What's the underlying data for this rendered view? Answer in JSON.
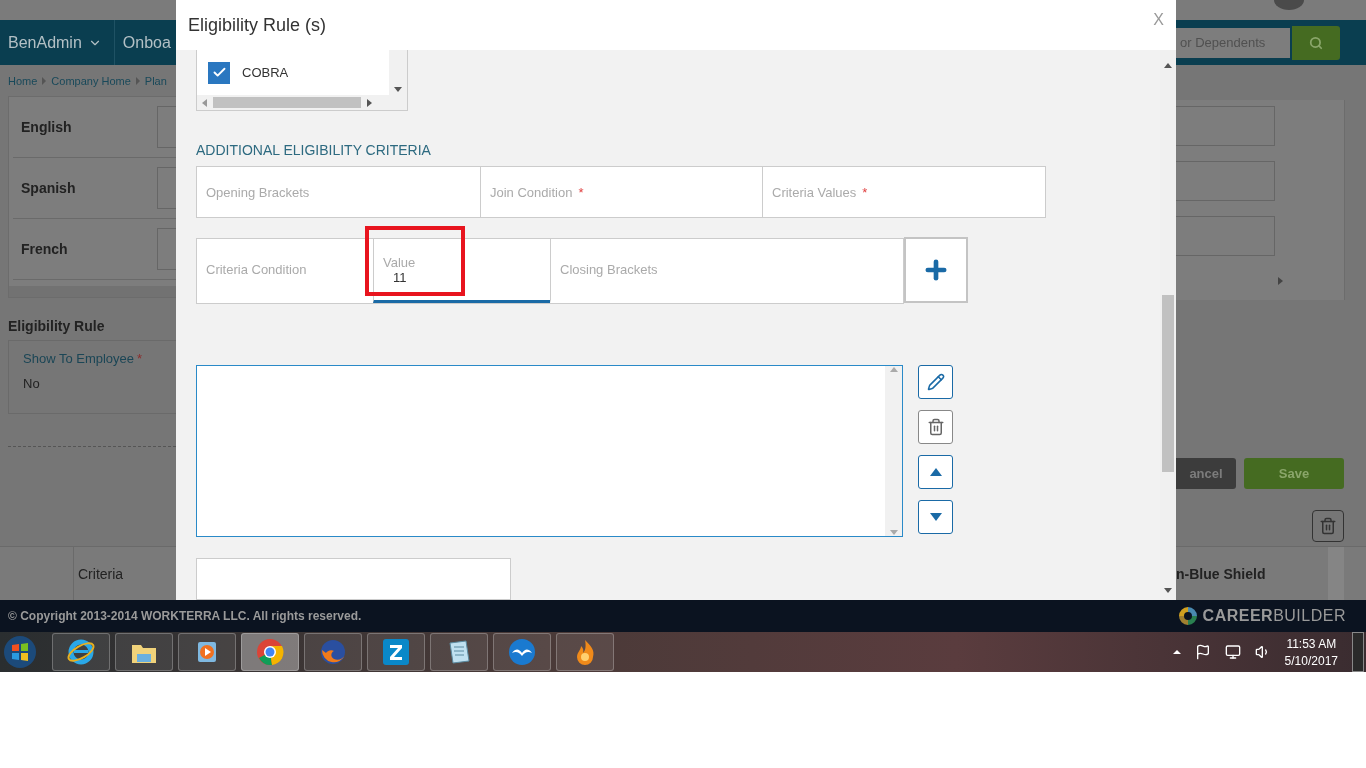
{
  "background": {
    "nav": [
      "BenAdmin",
      "Onboa"
    ],
    "search_placeholder": "or Dependents",
    "breadcrumb": [
      "Home",
      "Company Home",
      "Plan"
    ],
    "languages": [
      "English",
      "Spanish",
      "French"
    ],
    "eligibility": {
      "title": "Eligibility Rule",
      "field_label": "Show To Employee",
      "required_mark": "*",
      "value": "No"
    },
    "buttons": [
      {
        "label": "ancel",
        "kind": "cancel"
      },
      {
        "label": "Save",
        "kind": "save"
      }
    ],
    "table_headers": [
      "Criteria",
      "n-Blue Shield"
    ]
  },
  "modal": {
    "title": "Eligibility Rule (s)",
    "close": "X",
    "list": [
      {
        "label": "COBRA",
        "checked": true
      }
    ],
    "section_title": "ADDITIONAL ELIGIBILITY CRITERIA",
    "row_1": [
      {
        "label": "Opening Brackets"
      },
      {
        "label": "Join Condition",
        "required_mark": "*"
      },
      {
        "label": "Criteria Values",
        "required_mark": "*"
      }
    ],
    "row_2": [
      {
        "label": "Criteria Condition",
        "focused": false,
        "annotated": false
      },
      {
        "label": "Value",
        "value": "11",
        "focused": true,
        "annotated": true
      },
      {
        "label": "Closing Brackets",
        "focused": false,
        "annotated": false
      }
    ],
    "actions": [
      {
        "kind": "edit"
      },
      {
        "kind": "delete"
      },
      {
        "kind": "up"
      },
      {
        "kind": "down"
      }
    ]
  },
  "footer": {
    "copyright": "© Copyright 2013-2014 WORKTERRA LLC. All rights reserved.",
    "logo": "**CAREER**BUILDER"
  },
  "taskbar": {
    "apps": [
      {
        "kind": "ie",
        "selected": false
      },
      {
        "kind": "folder",
        "selected": false
      },
      {
        "kind": "media",
        "selected": false
      },
      {
        "kind": "chrome",
        "selected": true
      },
      {
        "kind": "firefox",
        "selected": false
      },
      {
        "kind": "z",
        "selected": false
      },
      {
        "kind": "notepad",
        "selected": false
      },
      {
        "kind": "office",
        "selected": false
      },
      {
        "kind": "flame",
        "selected": false
      }
    ],
    "clock": {
      "time": "11:53 AM",
      "date": "5/10/2017"
    }
  }
}
